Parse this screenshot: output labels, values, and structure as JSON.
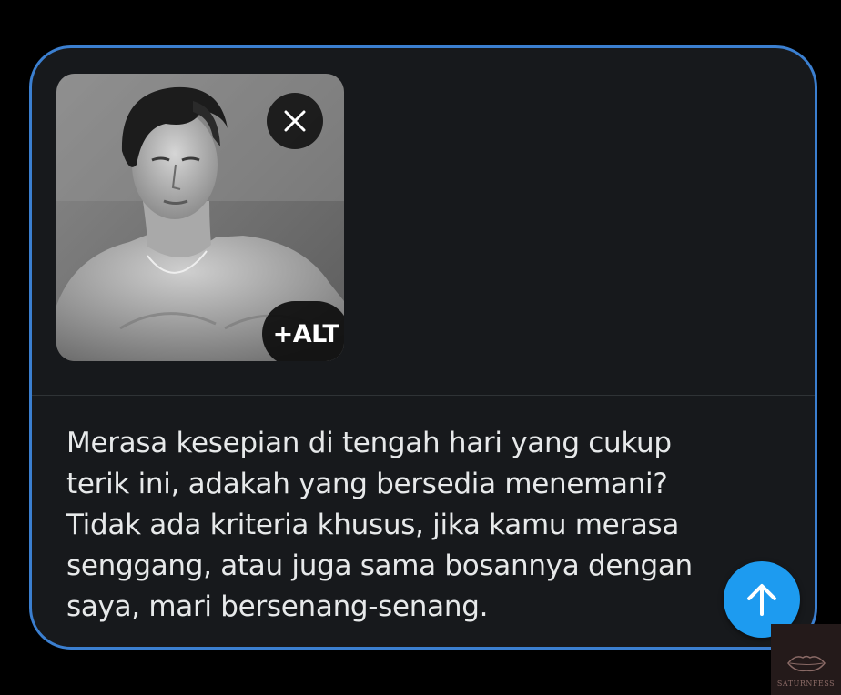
{
  "media": {
    "image_label": "Black and white photo of a person",
    "remove_label": "Remove media",
    "alt_button_label": "+ALT"
  },
  "post": {
    "text": "Merasa kesepian di tengah hari yang cukup\nterik ini, adakah yang bersedia menemani?\nTidak ada kriteria khusus, jika kamu merasa\nsenggang, atau juga sama bosannya dengan\nsaya, mari bersenang-senang."
  },
  "actions": {
    "scroll_top_icon": "arrow-up-icon",
    "remove_icon": "close-icon"
  },
  "watermark": {
    "text": "SATURNFESS"
  },
  "colors": {
    "background": "#000000",
    "card": "#17191c",
    "border": "#3b7fd0",
    "accent": "#1d9bf0",
    "text": "#e7e9ea"
  }
}
